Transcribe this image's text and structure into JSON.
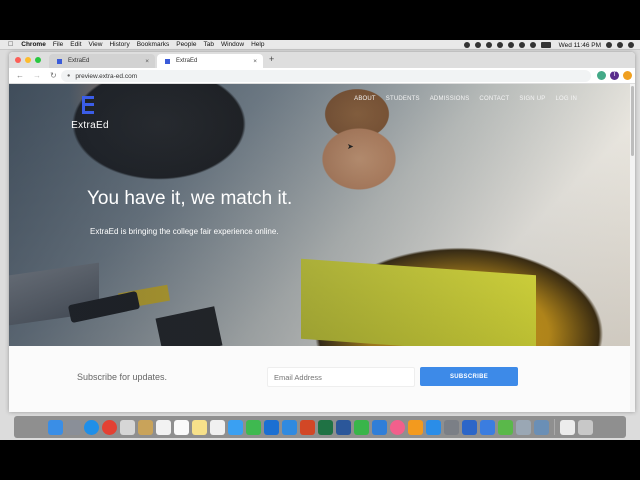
{
  "menubar": {
    "apple": "",
    "app_name": "Chrome",
    "items": [
      "File",
      "Edit",
      "View",
      "History",
      "Bookmarks",
      "People",
      "Tab",
      "Window",
      "Help"
    ],
    "clock": "Wed 11:46 PM"
  },
  "browser": {
    "tabs": [
      {
        "title": "ExtraEd",
        "active": false
      },
      {
        "title": "ExtraEd",
        "active": true
      }
    ],
    "new_tab": "+",
    "close": "×",
    "back": "←",
    "forward": "→",
    "reload": "C",
    "url": "preview.extra-ed.com",
    "profile_initial": "T"
  },
  "site": {
    "logo_text": "ExtraEd",
    "nav": [
      "ABOUT",
      "STUDENTS",
      "ADMISSIONS",
      "CONTACT",
      "SIGN UP",
      "LOG IN"
    ],
    "headline": "You have it, we match it.",
    "subheadline": "ExtraEd is bringing the college fair experience online.",
    "subscribe_label": "Subscribe for updates.",
    "email_placeholder": "Email Address",
    "subscribe_button": "SUBSCRIBE"
  },
  "colors": {
    "brand_blue": "#3b5de8",
    "button_blue": "#3d8ae8"
  },
  "dock": {
    "icons": [
      "finder-icon",
      "launchpad-icon",
      "safari-icon",
      "chrome-icon",
      "airmail-icon",
      "notes-app-icon",
      "calendar-icon",
      "reminders-icon",
      "notes-icon",
      "photos-icon",
      "messages-icon",
      "facetime-icon",
      "outlook-icon",
      "onedrive-icon",
      "powerpoint-icon",
      "excel-icon",
      "word-icon",
      "numbers-icon",
      "keynote-icon",
      "itunes-icon",
      "ibooks-icon",
      "app-store-icon",
      "system-preferences-icon",
      "vpn-icon",
      "browser-icon",
      "cleaner-icon",
      "utility-icon",
      "preview-icon",
      "documents-icon",
      "trash-icon"
    ]
  }
}
